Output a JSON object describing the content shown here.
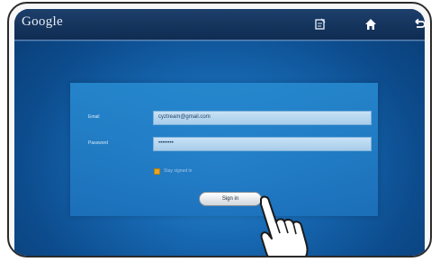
{
  "header": {
    "logo_text": "Google",
    "icons": [
      "edit-note-icon",
      "home-icon",
      "back-icon"
    ]
  },
  "login": {
    "email_label": "Email",
    "email_value": "cyztream@gmail.com",
    "password_label": "Password",
    "password_value": "••••••••",
    "remember_label": "Stay signed in",
    "signin_label": "Sign in"
  },
  "colors": {
    "screen_blue": "#1769b3",
    "topbar": "#1d3f6b",
    "panel": "#288cd2",
    "checkbox": "#e1a62a"
  }
}
